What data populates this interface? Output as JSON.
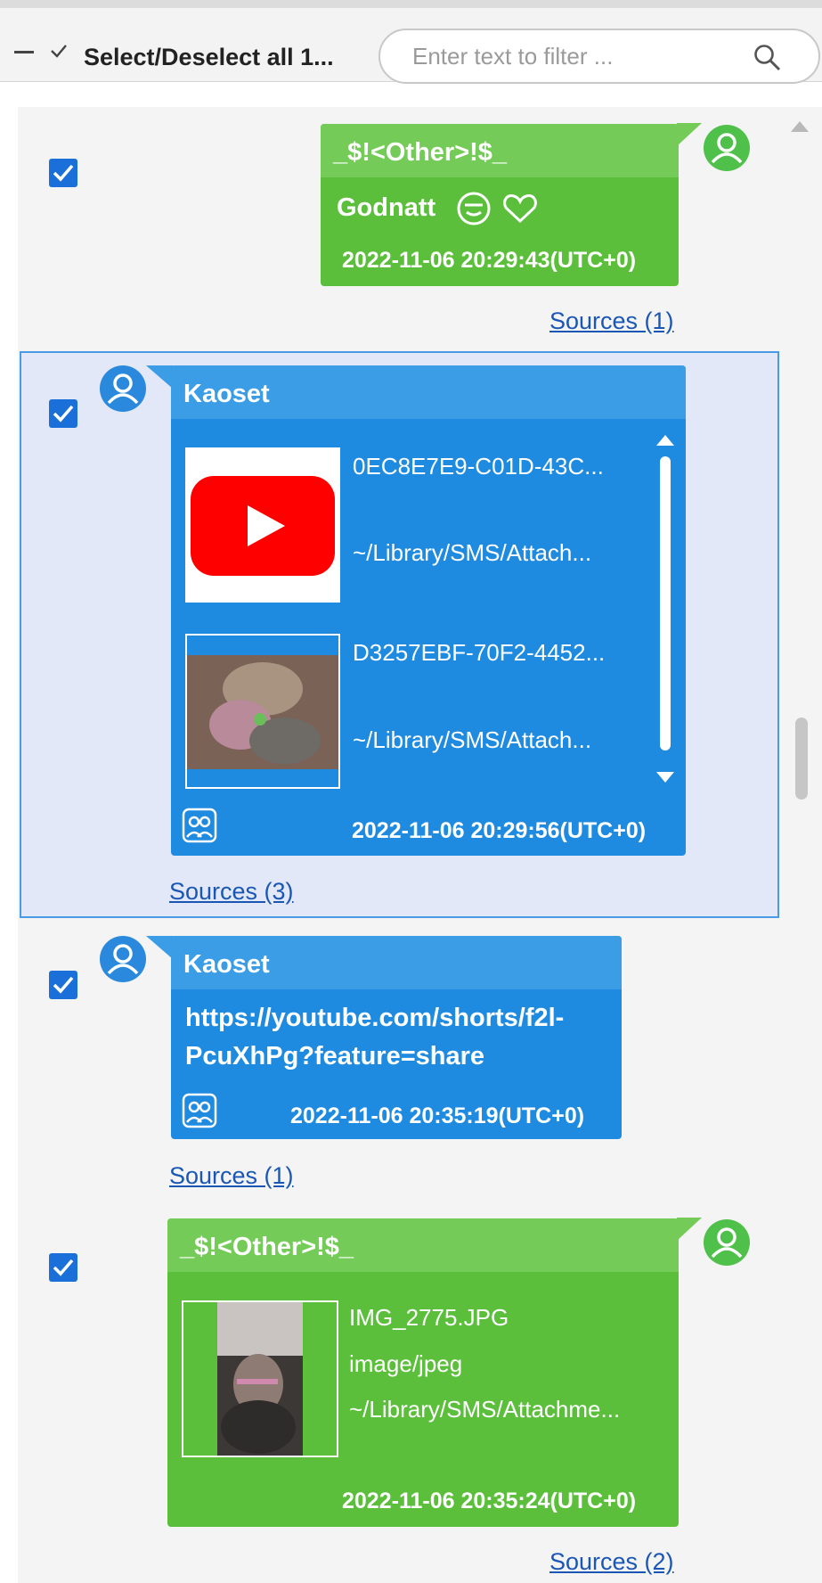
{
  "toolbar": {
    "select_all_label": "Select/Deselect all 1...",
    "filter_placeholder": "Enter text to filter ..."
  },
  "colors": {
    "outgoing_bubble": "#5bbf3c",
    "incoming_bubble": "#1f8be0",
    "selection": "#e2e8f8",
    "link": "#1a57b5"
  },
  "messages": [
    {
      "direction": "outgoing",
      "sender": "_$!<Other>!$_",
      "text": "Godnatt",
      "emojis": [
        "face-icon",
        "heart-icon"
      ],
      "timestamp": "2022-11-06 20:29:43(UTC+0)",
      "sources": "Sources (1)",
      "checked": true
    },
    {
      "direction": "incoming",
      "sender": "Kaoset",
      "selected": true,
      "attachments": [
        {
          "name": "0EC8E7E9-C01D-43C...",
          "path": "~/Library/SMS/Attach...",
          "thumb": "youtube-thumbnail"
        },
        {
          "name": "D3257EBF-70F2-4452...",
          "path": "~/Library/SMS/Attach...",
          "thumb": "photo-thumbnail"
        }
      ],
      "timestamp": "2022-11-06 20:29:56(UTC+0)",
      "sources": "Sources (3)",
      "checked": true
    },
    {
      "direction": "incoming",
      "sender": "Kaoset",
      "text_line1": "https://youtube.com/shorts/f2l-",
      "text_line2": "PcuXhPg?feature=share",
      "timestamp": "2022-11-06 20:35:19(UTC+0)",
      "sources": "Sources (1)",
      "checked": true
    },
    {
      "direction": "outgoing",
      "sender": "_$!<Other>!$_",
      "attachment": {
        "name": "IMG_2775.JPG",
        "mime": "image/jpeg",
        "path": "~/Library/SMS/Attachme..."
      },
      "timestamp": "2022-11-06 20:35:24(UTC+0)",
      "sources": "Sources (2)",
      "checked": true
    }
  ]
}
